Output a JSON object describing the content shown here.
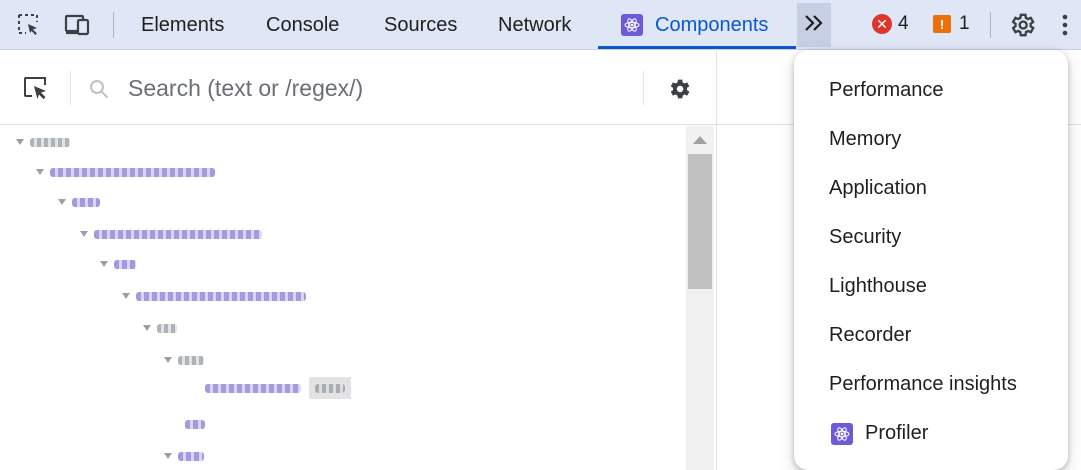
{
  "toolbar": {
    "tabs": [
      {
        "label": "Elements"
      },
      {
        "label": "Console"
      },
      {
        "label": "Sources"
      },
      {
        "label": "Network"
      },
      {
        "label": "Components",
        "active": true
      }
    ],
    "error_count": "4",
    "warning_count": "1",
    "icons": {
      "inspect": "inspect-element-icon",
      "device": "device-toolbar-icon",
      "more_tabs": "chevron-double-right-icon",
      "settings": "gear-icon",
      "kebab": "more-vertical-icon"
    },
    "colors": {
      "accent": "#0b57d0",
      "error": "#dc362e",
      "warning": "#e8710a",
      "react": "#6c5ad6"
    }
  },
  "components_panel": {
    "search": {
      "placeholder": "Search (text or /regex/)",
      "value": ""
    },
    "tree_key_tag": "Asi"
  },
  "overflow_menu": {
    "items": [
      {
        "label": "Performance"
      },
      {
        "label": "Memory"
      },
      {
        "label": "Application"
      },
      {
        "label": "Security"
      },
      {
        "label": "Lighthouse"
      },
      {
        "label": "Recorder"
      },
      {
        "label": "Performance insights"
      },
      {
        "label": "Profiler",
        "icon": "react-icon"
      }
    ]
  }
}
